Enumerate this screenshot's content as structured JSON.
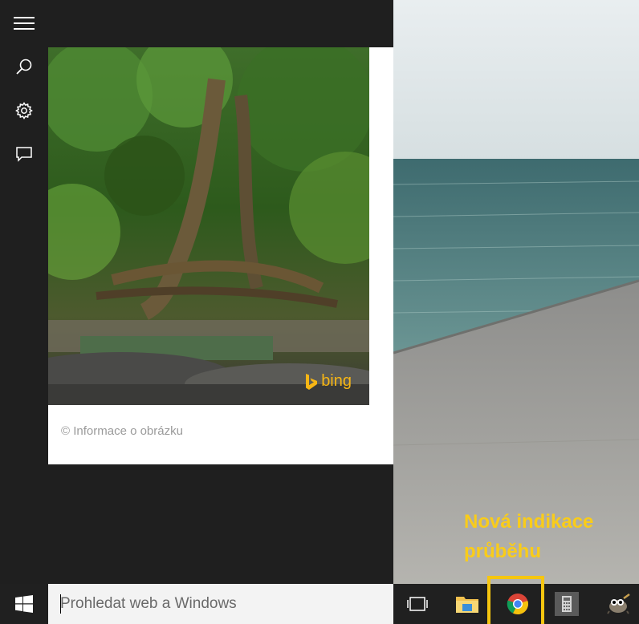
{
  "rail": {
    "items": [
      {
        "name": "menu",
        "icon": "hamburger-icon"
      },
      {
        "name": "search",
        "icon": "search-icon"
      },
      {
        "name": "settings",
        "icon": "gear-icon"
      },
      {
        "name": "feedback",
        "icon": "chat-icon"
      }
    ]
  },
  "card": {
    "image_credit": "© Informace o obrázku",
    "bing_logo": "bing"
  },
  "annotation": {
    "text": "Nová indikace průběhu",
    "color": "#f9cc1a"
  },
  "taskbar": {
    "search_placeholder": "Prohledat web a Windows",
    "apps": [
      {
        "name": "task-view",
        "icon": "task-view-icon"
      },
      {
        "name": "file-explorer",
        "icon": "folder-icon"
      },
      {
        "name": "chrome",
        "icon": "chrome-icon",
        "progress_indicator": true
      },
      {
        "name": "calculator",
        "icon": "calculator-icon"
      },
      {
        "name": "gimp",
        "icon": "gimp-icon"
      }
    ],
    "highlight_color": "#f6c60f"
  }
}
